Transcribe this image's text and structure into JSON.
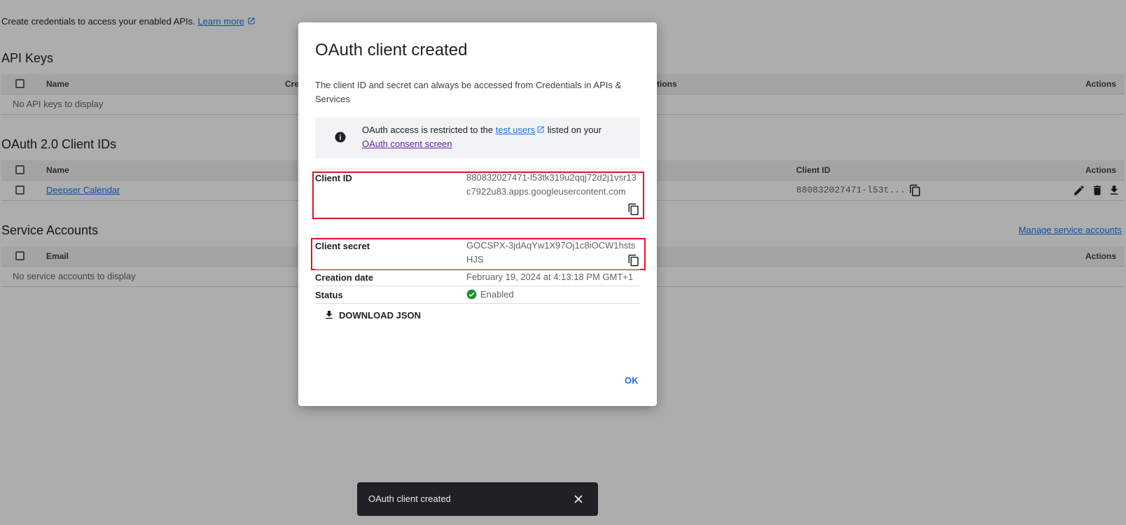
{
  "intro": {
    "text": "Create credentials to access your enabled APIs.",
    "learn_more": "Learn more"
  },
  "api_keys": {
    "title": "API Keys",
    "columns": [
      "Name",
      "Cre",
      "tions",
      "Actions"
    ],
    "empty": "No API keys to display"
  },
  "oauth_clients": {
    "title": "OAuth 2.0 Client IDs",
    "columns": {
      "name": "Name",
      "client_id": "Client ID",
      "actions": "Actions"
    },
    "rows": [
      {
        "name": "Deepser Calendar",
        "client_id": "880832027471-l53t..."
      }
    ]
  },
  "service_accounts": {
    "title": "Service Accounts",
    "manage": "Manage service accounts",
    "columns": {
      "email": "Email",
      "actions": "Actions"
    },
    "empty": "No service accounts to display"
  },
  "dialog": {
    "title": "OAuth client created",
    "description": "The client ID and secret can always be accessed from Credentials in APIs & Services",
    "info": {
      "prefix": "OAuth access is restricted to the ",
      "test_users": "test users",
      "middle": " listed on your ",
      "consent": "OAuth consent screen"
    },
    "client_id_label": "Client ID",
    "client_id_value": "880832027471-l53tk319u2qqj72d2j1vsr13c7922u83.apps.googleusercontent.com",
    "client_secret_label": "Client secret",
    "client_secret_value": "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",
    "creation_label": "Creation date",
    "creation_value": "February 19, 2024 at 4:13:18 PM GMT+1",
    "status_label": "Status",
    "status_value": "Enabled",
    "download": "DOWNLOAD JSON",
    "ok": "OK"
  },
  "snackbar": {
    "text": "OAuth client created"
  },
  "colors": {
    "accent": "#1a73e8",
    "highlight": "#e0131f",
    "success": "#1e8e3e"
  }
}
